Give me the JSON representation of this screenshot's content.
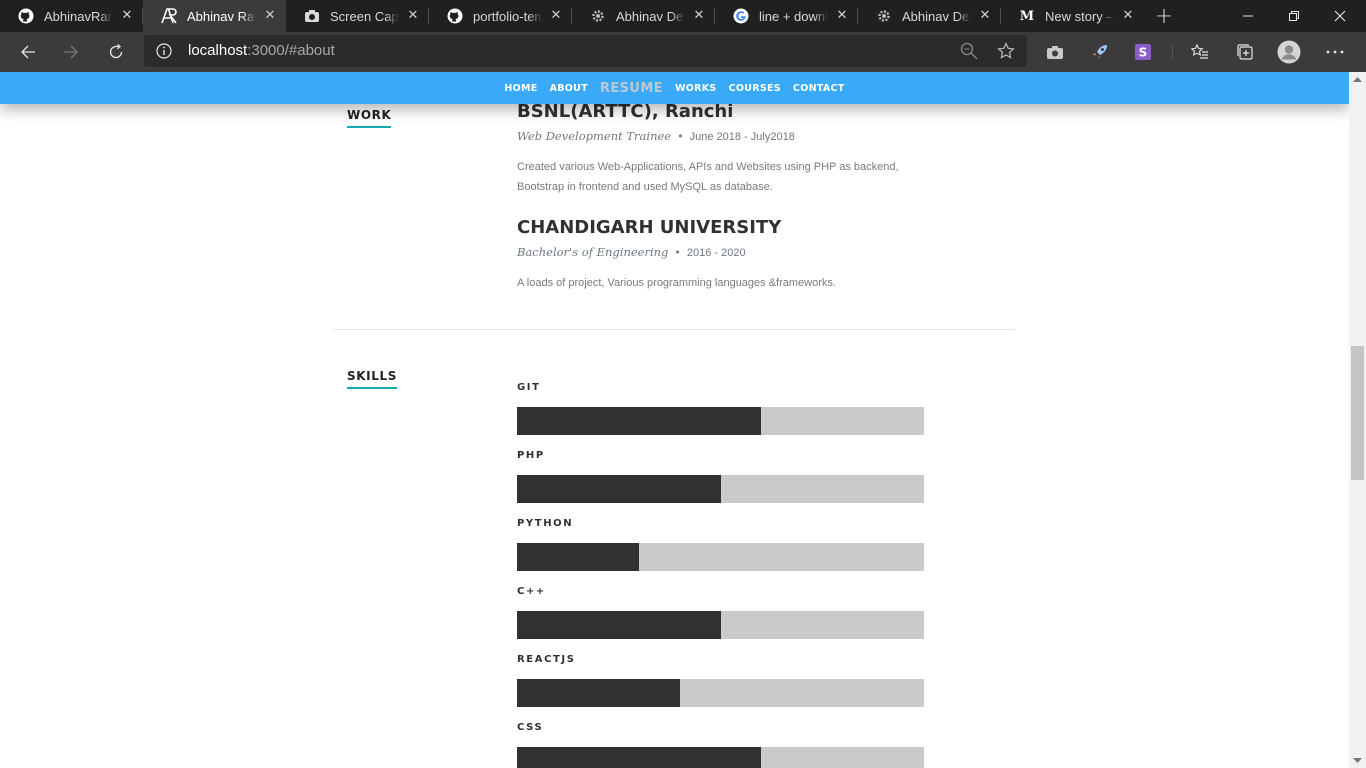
{
  "browser": {
    "tabs": [
      {
        "title": "AbhinavRan/Portfolio",
        "icon": "github-icon",
        "active": false
      },
      {
        "title": "Abhinav Ranjan",
        "icon": "ar-logo-icon",
        "active": true
      },
      {
        "title": "Screen Capture",
        "icon": "camera-icon",
        "active": false
      },
      {
        "title": "portfolio-template",
        "icon": "github-icon",
        "active": false
      },
      {
        "title": "Abhinav Dev",
        "icon": "gear-icon",
        "active": false
      },
      {
        "title": "line + download",
        "icon": "google-icon",
        "active": false
      },
      {
        "title": "Abhinav Dev",
        "icon": "gear-icon",
        "active": false
      },
      {
        "title": "New story – Medium",
        "icon": "medium-icon",
        "active": false
      }
    ],
    "url_host": "localhost",
    "url_rest": ":3000/#about"
  },
  "nav": {
    "items": [
      "HOME",
      "ABOUT",
      "RESUME",
      "WORKS",
      "COURSES",
      "CONTACT"
    ],
    "current": "RESUME",
    "bar_color": "#39a9f8"
  },
  "work": {
    "label": "WORK",
    "entries": [
      {
        "title": "BSNL(ARTTC), Ranchi",
        "role": "Web Development Trainee",
        "dates": "June 2018 - July2018",
        "description": "Created various Web-Applications, APIs and Websites using PHP as backend, Bootstrap in frontend and used MySQL as database."
      },
      {
        "title": "CHANDIGARH UNIVERSITY",
        "role": "Bachelor's of Engineering",
        "dates": "2016 - 2020",
        "description": "A loads of project, Various programming languages &frameworks."
      }
    ]
  },
  "skills": {
    "label": "SKILLS",
    "accent_color": "#11abb0",
    "items": [
      {
        "name": "GIT",
        "level": 0.6
      },
      {
        "name": "PHP",
        "level": 0.5
      },
      {
        "name": "PYTHON",
        "level": 0.3
      },
      {
        "name": "C++",
        "level": 0.5
      },
      {
        "name": "REACTJS",
        "level": 0.4
      },
      {
        "name": "CSS",
        "level": 0.6
      }
    ]
  }
}
